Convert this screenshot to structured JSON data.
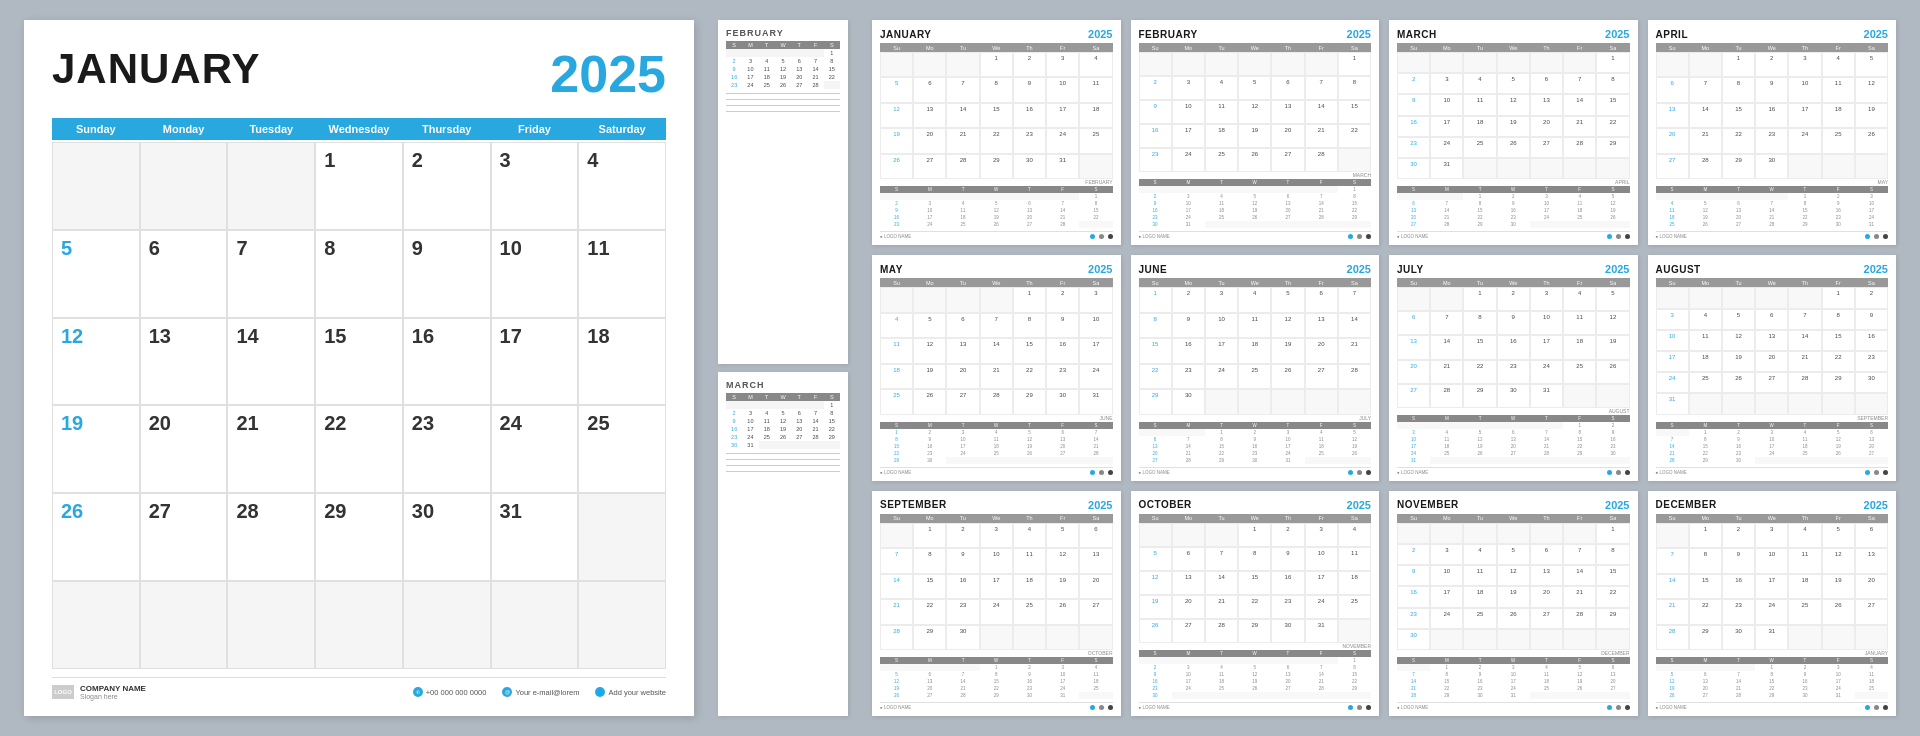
{
  "bg_color": "#b0b8c1",
  "accent_color": "#29a8e0",
  "big_calendar": {
    "month": "JANUARY",
    "year": "2025",
    "day_headers": [
      "Sunday",
      "Monday",
      "Tuesday",
      "Wednesday",
      "Thursday",
      "Friday",
      "Saturday"
    ],
    "weeks": [
      [
        "",
        "",
        "",
        "1",
        "2",
        "3",
        "4"
      ],
      [
        "5",
        "6",
        "7",
        "8",
        "9",
        "10",
        "11"
      ],
      [
        "12",
        "13",
        "14",
        "15",
        "16",
        "17",
        "18"
      ],
      [
        "19",
        "20",
        "21",
        "22",
        "23",
        "24",
        "25"
      ],
      [
        "26",
        "27",
        "28",
        "29",
        "30",
        "31",
        ""
      ],
      [
        "",
        "",
        "",
        "",
        "",
        "",
        ""
      ]
    ],
    "sunday_indices": [
      0
    ],
    "footer": {
      "logo_text": "LOGO",
      "company_name": "COMPANY NAME",
      "slogan": "Slogan here",
      "phone": "+00 000 000 0000",
      "email": "Your e-mail@lorem",
      "website": "Add your website"
    }
  },
  "side_calendars": [
    {
      "month": "FEBRUARY",
      "day_headers": [
        "S",
        "M",
        "T",
        "W",
        "T",
        "F",
        "S"
      ],
      "weeks": [
        [
          "",
          "",
          "",
          "",
          "",
          "",
          "1"
        ],
        [
          "2",
          "3",
          "4",
          "5",
          "6",
          "7",
          "8"
        ],
        [
          "9",
          "10",
          "11",
          "12",
          "13",
          "14",
          "15"
        ],
        [
          "16",
          "17",
          "18",
          "19",
          "20",
          "21",
          "22"
        ],
        [
          "23",
          "24",
          "25",
          "26",
          "27",
          "28",
          ""
        ]
      ]
    },
    {
      "month": "MARCH",
      "day_headers": [
        "S",
        "M",
        "T",
        "W",
        "T",
        "F",
        "S"
      ],
      "weeks": [
        [
          "",
          "",
          "",
          "",
          "",
          "",
          "1"
        ],
        [
          "2",
          "3",
          "4",
          "5",
          "6",
          "7",
          "8"
        ],
        [
          "9",
          "10",
          "11",
          "12",
          "13",
          "14",
          "15"
        ],
        [
          "16",
          "17",
          "18",
          "19",
          "20",
          "21",
          "22"
        ],
        [
          "23",
          "24",
          "25",
          "26",
          "27",
          "28",
          "29"
        ],
        [
          "30",
          "31",
          "",
          "",
          "",
          "",
          ""
        ]
      ]
    }
  ],
  "months_grid": [
    {
      "month": "JANUARY",
      "year": "2025",
      "day_headers": [
        "Su",
        "Mo",
        "Tu",
        "We",
        "Th",
        "Fr",
        "Sa"
      ],
      "weeks": [
        [
          "",
          "",
          "",
          "1",
          "2",
          "3",
          "4"
        ],
        [
          "5",
          "6",
          "7",
          "8",
          "9",
          "10",
          "11"
        ],
        [
          "12",
          "13",
          "14",
          "15",
          "16",
          "17",
          "18"
        ],
        [
          "19",
          "20",
          "21",
          "22",
          "23",
          "24",
          "25"
        ],
        [
          "26",
          "27",
          "28",
          "29",
          "30",
          "31",
          ""
        ]
      ],
      "next_month_label": "FEBRUARY"
    },
    {
      "month": "FEBRUARY",
      "year": "2025",
      "day_headers": [
        "Su",
        "Mo",
        "Tu",
        "We",
        "Th",
        "Fr",
        "Sa"
      ],
      "weeks": [
        [
          "",
          "",
          "",
          "",
          "",
          "",
          "1"
        ],
        [
          "2",
          "3",
          "4",
          "5",
          "6",
          "7",
          "8"
        ],
        [
          "9",
          "10",
          "11",
          "12",
          "13",
          "14",
          "15"
        ],
        [
          "16",
          "17",
          "18",
          "19",
          "20",
          "21",
          "22"
        ],
        [
          "23",
          "24",
          "25",
          "26",
          "27",
          "28",
          ""
        ]
      ],
      "next_month_label": "MARCH"
    },
    {
      "month": "MARCH",
      "year": "2025",
      "day_headers": [
        "Su",
        "Mo",
        "Tu",
        "We",
        "Th",
        "Fr",
        "Sa"
      ],
      "weeks": [
        [
          "",
          "",
          "",
          "",
          "",
          "",
          "1"
        ],
        [
          "2",
          "3",
          "4",
          "5",
          "6",
          "7",
          "8"
        ],
        [
          "9",
          "10",
          "11",
          "12",
          "13",
          "14",
          "15"
        ],
        [
          "16",
          "17",
          "18",
          "19",
          "20",
          "21",
          "22"
        ],
        [
          "23",
          "24",
          "25",
          "26",
          "27",
          "28",
          "29"
        ],
        [
          "30",
          "31",
          "",
          "",
          "",
          "",
          ""
        ]
      ],
      "next_month_label": "APRIL"
    },
    {
      "month": "APRIL",
      "year": "2025",
      "day_headers": [
        "Su",
        "Mo",
        "Tu",
        "We",
        "Th",
        "Fr",
        "Sa"
      ],
      "weeks": [
        [
          "",
          "",
          "1",
          "2",
          "3",
          "4",
          "5"
        ],
        [
          "6",
          "7",
          "8",
          "9",
          "10",
          "11",
          "12"
        ],
        [
          "13",
          "14",
          "15",
          "16",
          "17",
          "18",
          "19"
        ],
        [
          "20",
          "21",
          "22",
          "23",
          "24",
          "25",
          "26"
        ],
        [
          "27",
          "28",
          "29",
          "30",
          "",
          "",
          ""
        ]
      ],
      "next_month_label": "MAY"
    },
    {
      "month": "MAY",
      "year": "2025",
      "day_headers": [
        "Su",
        "Mo",
        "Tu",
        "We",
        "Th",
        "Fr",
        "Sa"
      ],
      "weeks": [
        [
          "",
          "",
          "",
          "",
          "1",
          "2",
          "3"
        ],
        [
          "4",
          "5",
          "6",
          "7",
          "8",
          "9",
          "10"
        ],
        [
          "11",
          "12",
          "13",
          "14",
          "15",
          "16",
          "17"
        ],
        [
          "18",
          "19",
          "20",
          "21",
          "22",
          "23",
          "24"
        ],
        [
          "25",
          "26",
          "27",
          "28",
          "29",
          "30",
          "31"
        ]
      ],
      "next_month_label": "JUNE"
    },
    {
      "month": "JUNE",
      "year": "2025",
      "day_headers": [
        "Su",
        "Mo",
        "Tu",
        "We",
        "Th",
        "Fr",
        "Sa"
      ],
      "weeks": [
        [
          "1",
          "2",
          "3",
          "4",
          "5",
          "6",
          "7"
        ],
        [
          "8",
          "9",
          "10",
          "11",
          "12",
          "13",
          "14"
        ],
        [
          "15",
          "16",
          "17",
          "18",
          "19",
          "20",
          "21"
        ],
        [
          "22",
          "23",
          "24",
          "25",
          "26",
          "27",
          "28"
        ],
        [
          "29",
          "30",
          "",
          "",
          "",
          "",
          ""
        ]
      ],
      "next_month_label": "JULY"
    },
    {
      "month": "JULY",
      "year": "2025",
      "day_headers": [
        "Su",
        "Mo",
        "Tu",
        "We",
        "Th",
        "Fr",
        "Sa"
      ],
      "weeks": [
        [
          "",
          "",
          "1",
          "2",
          "3",
          "4",
          "5"
        ],
        [
          "6",
          "7",
          "8",
          "9",
          "10",
          "11",
          "12"
        ],
        [
          "13",
          "14",
          "15",
          "16",
          "17",
          "18",
          "19"
        ],
        [
          "20",
          "21",
          "22",
          "23",
          "24",
          "25",
          "26"
        ],
        [
          "27",
          "28",
          "29",
          "30",
          "31",
          "",
          ""
        ]
      ],
      "next_month_label": "AUGUST"
    },
    {
      "month": "AUGUST",
      "year": "2025",
      "day_headers": [
        "Su",
        "Mo",
        "Tu",
        "We",
        "Th",
        "Fr",
        "Sa"
      ],
      "weeks": [
        [
          "",
          "",
          "",
          "",
          "",
          "1",
          "2"
        ],
        [
          "3",
          "4",
          "5",
          "6",
          "7",
          "8",
          "9"
        ],
        [
          "10",
          "11",
          "12",
          "13",
          "14",
          "15",
          "16"
        ],
        [
          "17",
          "18",
          "19",
          "20",
          "21",
          "22",
          "23"
        ],
        [
          "24",
          "25",
          "26",
          "27",
          "28",
          "29",
          "30"
        ],
        [
          "31",
          "",
          "",
          "",
          "",
          "",
          ""
        ]
      ],
      "next_month_label": "SEPTEMBER"
    },
    {
      "month": "SEPTEMBER",
      "year": "2025",
      "day_headers": [
        "Su",
        "Mo",
        "Tu",
        "We",
        "Th",
        "Fr",
        "Sa"
      ],
      "weeks": [
        [
          "",
          "1",
          "2",
          "3",
          "4",
          "5",
          "6"
        ],
        [
          "7",
          "8",
          "9",
          "10",
          "11",
          "12",
          "13"
        ],
        [
          "14",
          "15",
          "16",
          "17",
          "18",
          "19",
          "20"
        ],
        [
          "21",
          "22",
          "23",
          "24",
          "25",
          "26",
          "27"
        ],
        [
          "28",
          "29",
          "30",
          "",
          "",
          "",
          ""
        ]
      ],
      "next_month_label": "OCTOBER"
    },
    {
      "month": "OCTOBER",
      "year": "2025",
      "day_headers": [
        "Su",
        "Mo",
        "Tu",
        "We",
        "Th",
        "Fr",
        "Sa"
      ],
      "weeks": [
        [
          "",
          "",
          "",
          "1",
          "2",
          "3",
          "4"
        ],
        [
          "5",
          "6",
          "7",
          "8",
          "9",
          "10",
          "11"
        ],
        [
          "12",
          "13",
          "14",
          "15",
          "16",
          "17",
          "18"
        ],
        [
          "19",
          "20",
          "21",
          "22",
          "23",
          "24",
          "25"
        ],
        [
          "26",
          "27",
          "28",
          "29",
          "30",
          "31",
          ""
        ]
      ],
      "next_month_label": "NOVEMBER"
    },
    {
      "month": "NOVEMBER",
      "year": "2025",
      "day_headers": [
        "Su",
        "Mo",
        "Tu",
        "We",
        "Th",
        "Fr",
        "Sa"
      ],
      "weeks": [
        [
          "",
          "",
          "",
          "",
          "",
          "",
          "1"
        ],
        [
          "2",
          "3",
          "4",
          "5",
          "6",
          "7",
          "8"
        ],
        [
          "9",
          "10",
          "11",
          "12",
          "13",
          "14",
          "15"
        ],
        [
          "16",
          "17",
          "18",
          "19",
          "20",
          "21",
          "22"
        ],
        [
          "23",
          "24",
          "25",
          "26",
          "27",
          "28",
          "29"
        ],
        [
          "30",
          "",
          "",
          "",
          "",
          "",
          ""
        ]
      ],
      "next_month_label": "DECEMBER"
    },
    {
      "month": "DECEMBER",
      "year": "2025",
      "day_headers": [
        "Su",
        "Mo",
        "Tu",
        "We",
        "Th",
        "Fr",
        "Sa"
      ],
      "weeks": [
        [
          "",
          "1",
          "2",
          "3",
          "4",
          "5",
          "6"
        ],
        [
          "7",
          "8",
          "9",
          "10",
          "11",
          "12",
          "13"
        ],
        [
          "14",
          "15",
          "16",
          "17",
          "18",
          "19",
          "20"
        ],
        [
          "21",
          "22",
          "23",
          "24",
          "25",
          "26",
          "27"
        ],
        [
          "28",
          "29",
          "30",
          "31",
          "",
          "",
          ""
        ]
      ],
      "next_month_label": "JANUARY"
    }
  ],
  "footer_colors": [
    "#29a8e0",
    "#888888",
    "#444444"
  ]
}
